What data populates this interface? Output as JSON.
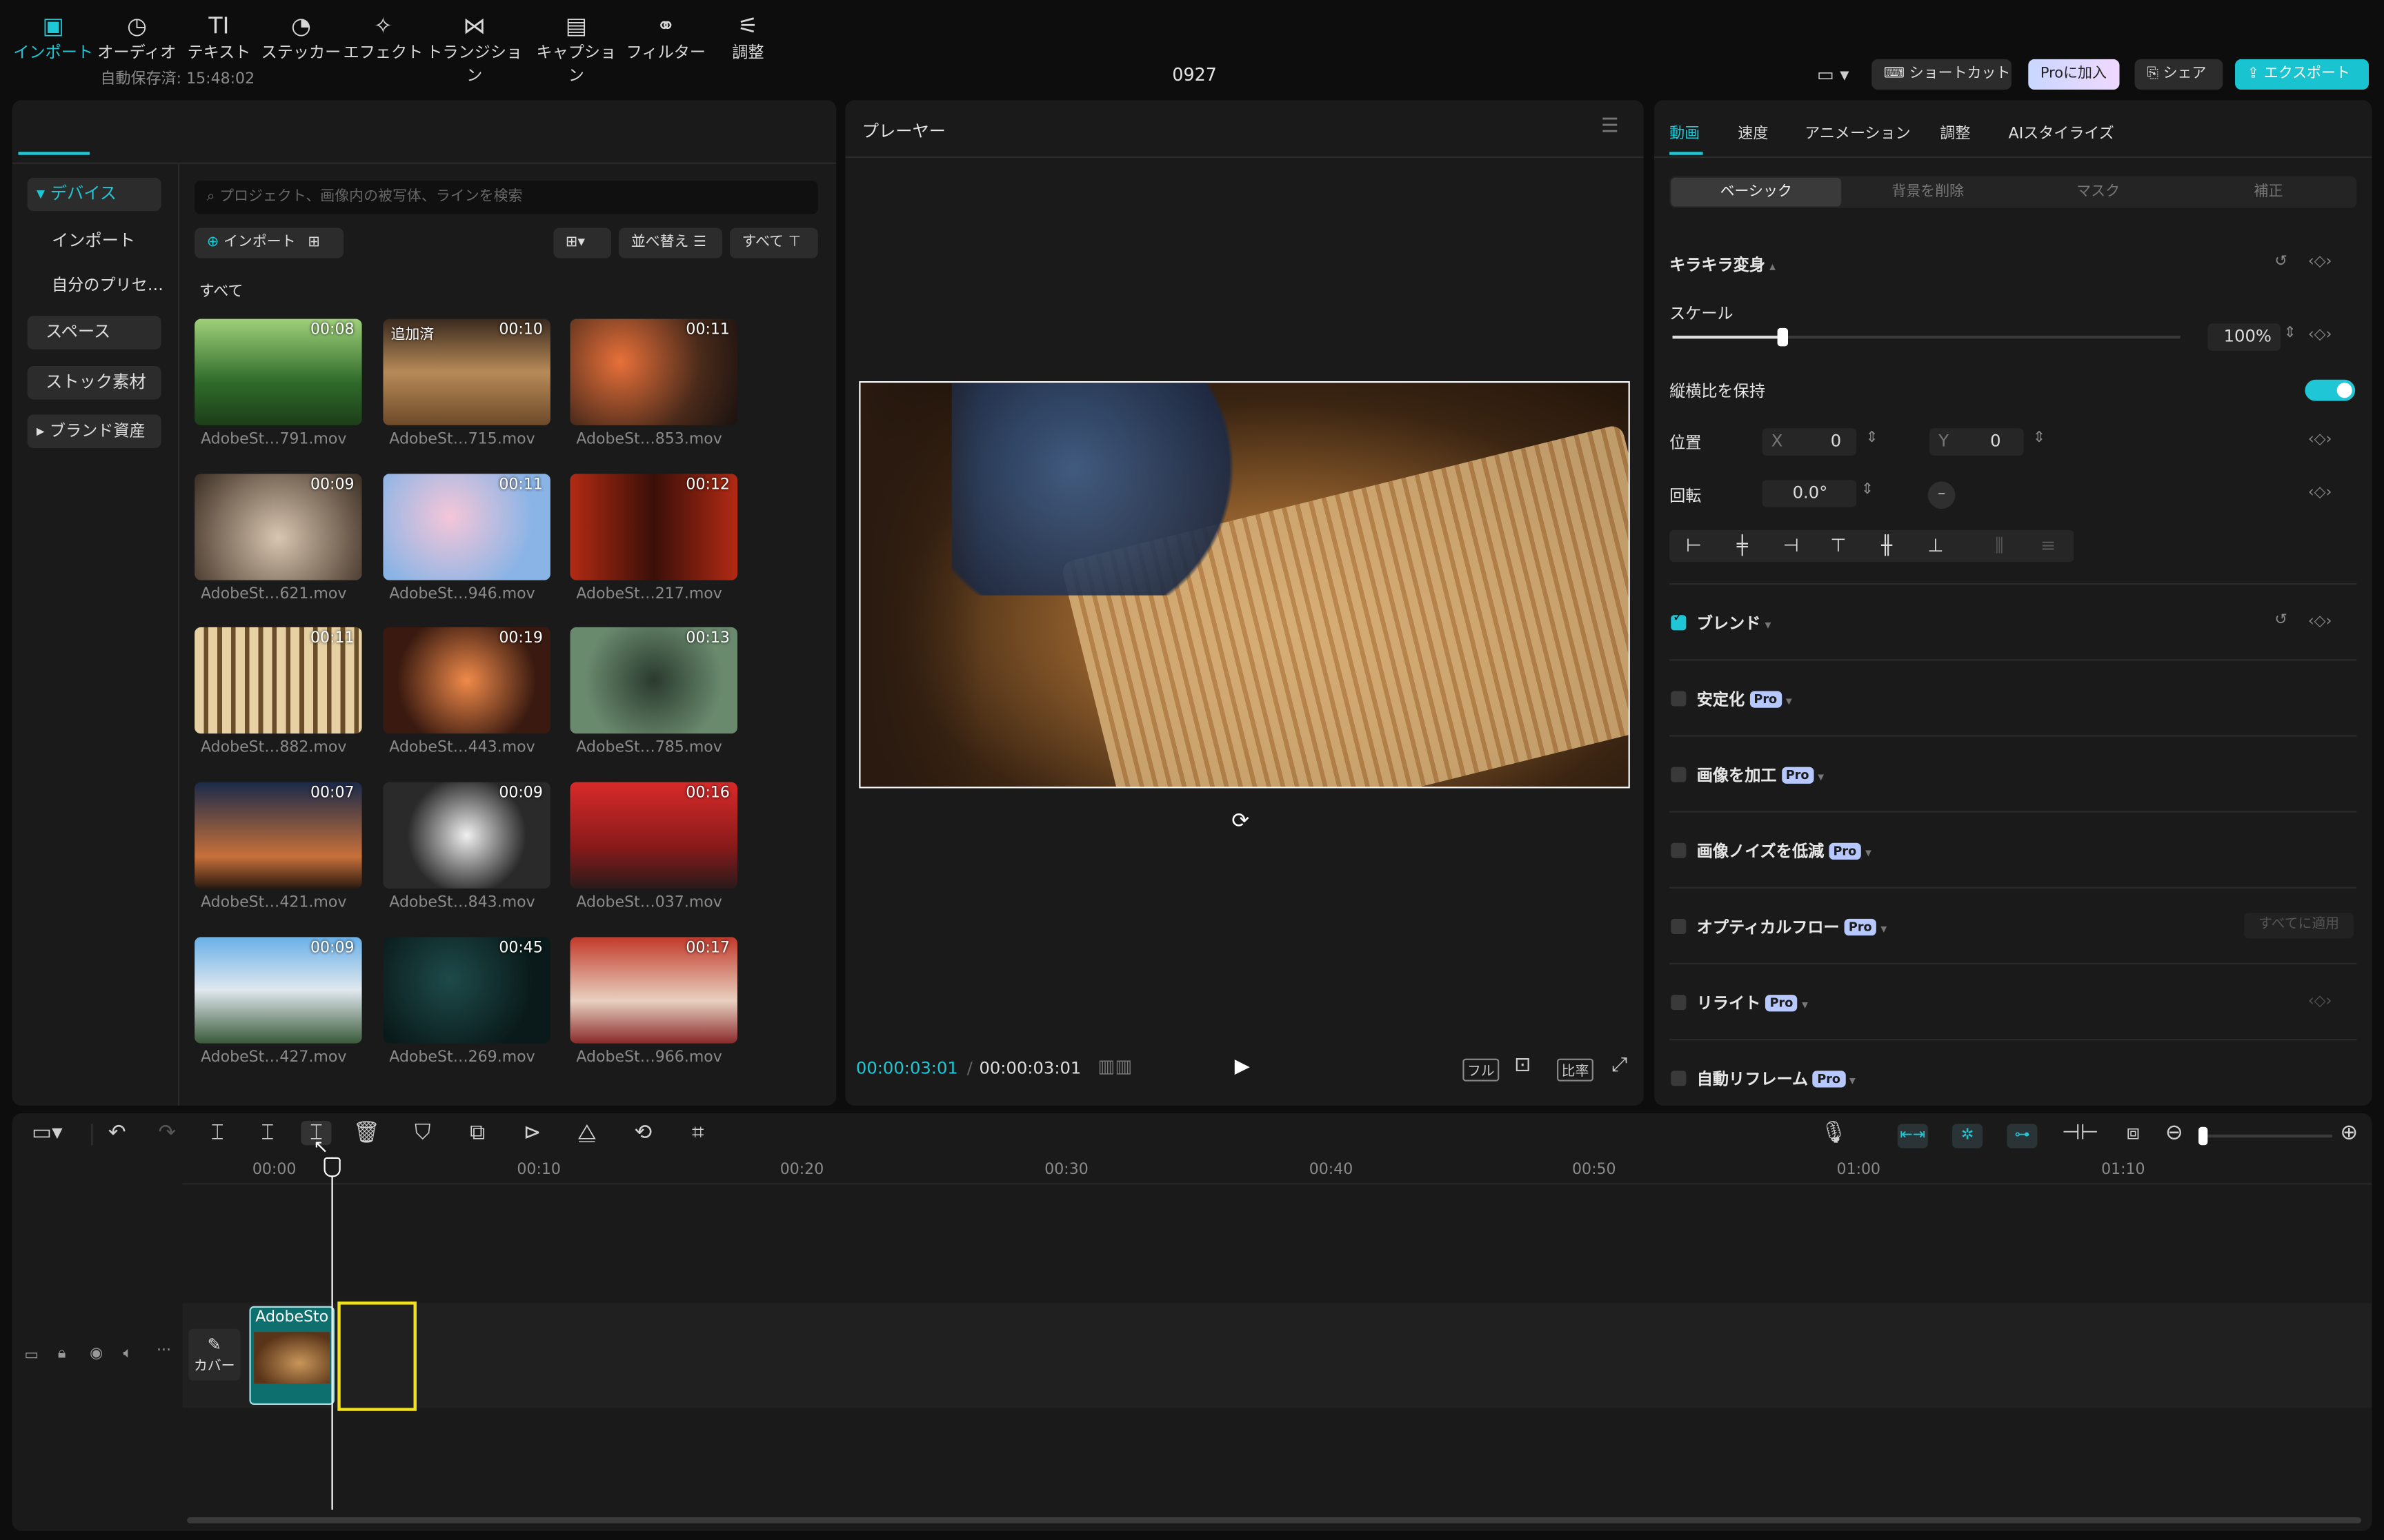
{
  "header": {
    "autosave": "自動保存済: 15:48:02",
    "project_title": "0927",
    "shortcut_label": "ショートカット",
    "pro_join_label": "Proに加入",
    "share_label": "シェア",
    "export_label": "エクスポート"
  },
  "toolbar": {
    "tabs": [
      {
        "label": "インポート",
        "icon": "import-icon",
        "glyph": "▣"
      },
      {
        "label": "オーディオ",
        "icon": "audio-icon",
        "glyph": "◷"
      },
      {
        "label": "テキスト",
        "icon": "text-icon",
        "glyph": "TI"
      },
      {
        "label": "ステッカー",
        "icon": "sticker-icon",
        "glyph": "◔"
      },
      {
        "label": "エフェクト",
        "icon": "effect-icon",
        "glyph": "✧"
      },
      {
        "label": "トランジション",
        "icon": "transition-icon",
        "glyph": "⋈"
      },
      {
        "label": "キャプション",
        "icon": "caption-icon",
        "glyph": "▤"
      },
      {
        "label": "フィルター",
        "icon": "filter-icon",
        "glyph": "⚭"
      },
      {
        "label": "調整",
        "icon": "adjust-icon",
        "glyph": "⚟"
      }
    ]
  },
  "sidebar": {
    "items": [
      "デバイス",
      "インポート",
      "自分のプリセ…",
      "スペース",
      "ストック素材",
      "ブランド資産"
    ]
  },
  "media": {
    "search_placeholder": "プロジェクト、画像内の被写体、ラインを検索",
    "import_label": "インポート",
    "sort_label": "並べ替え",
    "all_filter_label": "すべて",
    "section_label": "すべて",
    "items": [
      {
        "duration": "00:08",
        "name": "AdobeSt…791.mov",
        "tag": ""
      },
      {
        "duration": "00:10",
        "name": "AdobeSt…715.mov",
        "tag": "追加済"
      },
      {
        "duration": "00:11",
        "name": "AdobeSt…853.mov",
        "tag": ""
      },
      {
        "duration": "00:09",
        "name": "AdobeSt…621.mov",
        "tag": ""
      },
      {
        "duration": "00:11",
        "name": "AdobeSt…946.mov",
        "tag": ""
      },
      {
        "duration": "00:12",
        "name": "AdobeSt…217.mov",
        "tag": ""
      },
      {
        "duration": "00:11",
        "name": "AdobeSt…882.mov",
        "tag": ""
      },
      {
        "duration": "00:19",
        "name": "AdobeSt…443.mov",
        "tag": ""
      },
      {
        "duration": "00:13",
        "name": "AdobeSt…785.mov",
        "tag": ""
      },
      {
        "duration": "00:07",
        "name": "AdobeSt…421.mov",
        "tag": ""
      },
      {
        "duration": "00:09",
        "name": "AdobeSt…843.mov",
        "tag": ""
      },
      {
        "duration": "00:16",
        "name": "AdobeSt…037.mov",
        "tag": ""
      },
      {
        "duration": "00:09",
        "name": "AdobeSt…427.mov",
        "tag": ""
      },
      {
        "duration": "00:45",
        "name": "AdobeSt…269.mov",
        "tag": ""
      },
      {
        "duration": "00:17",
        "name": "AdobeSt…966.mov",
        "tag": ""
      }
    ]
  },
  "player": {
    "title": "プレーヤー",
    "current_time": "00:00:03:01",
    "total_time": "00:00:03:01",
    "full_label": "フル",
    "ratio_label": "比率"
  },
  "inspector": {
    "tabs": [
      "動画",
      "速度",
      "アニメーション",
      "調整",
      "AIスタイライズ"
    ],
    "subtabs": [
      "ベーシック",
      "背景を削除",
      "マスク",
      "補正"
    ],
    "transform_label": "キラキラ変身",
    "scale_label": "スケール",
    "scale_value": "100%",
    "scale_fraction": 0.1,
    "keep_ratio_label": "縦横比を保持",
    "position_label": "位置",
    "pos_x_label": "X",
    "pos_x": "0",
    "pos_y_label": "Y",
    "pos_y": "0",
    "rotation_label": "回転",
    "rotation_value": "0.0°",
    "blend_label": "ブレンド",
    "stabilize_label": "安定化",
    "enhance_label": "画像を加工",
    "denoise_label": "画像ノイズを低減",
    "optical_flow_label": "オプティカルフロー",
    "apply_all_label": "すべてに適用",
    "relight_label": "リライト",
    "auto_reframe_label": "自動リフレーム",
    "pro_badge": "Pro"
  },
  "timeline": {
    "ruler": [
      "00:00",
      "00:10",
      "00:20",
      "00:30",
      "00:40",
      "00:50",
      "01:00",
      "01:10"
    ],
    "cover_label": "カバー",
    "clip_label": "AdobeSto"
  },
  "colors": {
    "accent": "#1fc7d6",
    "export_bg": "#19c3d0",
    "selection": "#f3e21a"
  }
}
